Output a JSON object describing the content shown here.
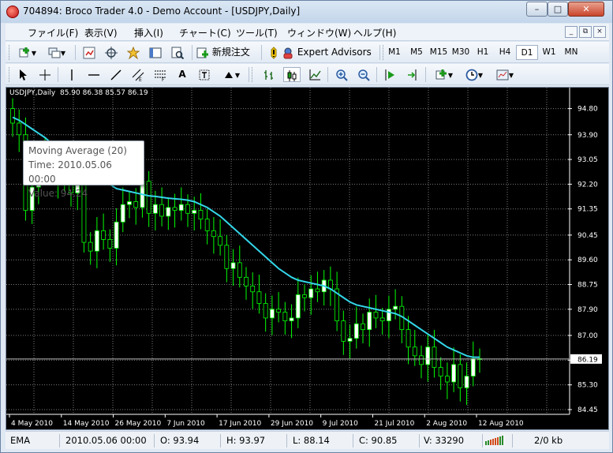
{
  "window": {
    "title": "704894: Broco Trader 4.0 - Demo Account - [USDJPY,Daily]",
    "minimize": "–",
    "maximize": "□",
    "close": "✕"
  },
  "menu": {
    "items": [
      "ファイル(F)",
      "表示(V)",
      "挿入(I)",
      "チャート(C)",
      "ツール(T)",
      "ウィンドウ(W)",
      "ヘルプ(H)"
    ],
    "mdi": [
      "_",
      "⧉",
      "×"
    ]
  },
  "toolbar1": {
    "new_order": "新規注文",
    "expert_advisors": "Expert Advisors",
    "timeframes": [
      "M1",
      "M5",
      "M15",
      "M30",
      "H1",
      "H4",
      "D1",
      "W1",
      "MN"
    ],
    "active_timeframe": "D1"
  },
  "toolbar2": {
    "text_tool": "A",
    "icons": [
      "cursor-icon",
      "crosshair-icon",
      "vertical-line-icon",
      "horizontal-line-icon",
      "trendline-icon",
      "equidistant-channel-icon",
      "fibonacci-icon",
      "text-icon",
      "text-label-icon",
      "arrows-icon",
      "bar-chart-icon",
      "candlestick-icon",
      "line-chart-icon",
      "zoom-in-icon",
      "zoom-out-icon",
      "chart-shift-icon",
      "autoscroll-icon",
      "indicators-icon",
      "periods-icon",
      "templates-icon"
    ]
  },
  "chart_header": {
    "symbol": "USDJPY,Daily",
    "ohlc": "85.90 86.38 85.57 86.19"
  },
  "tooltip": {
    "line1": "Moving Average (20)",
    "line2": "Time: 2010.05.06 00:00",
    "line3": "Value: 94.24"
  },
  "status": {
    "profile": "EMA",
    "datetime": "2010.05.06 00:00",
    "open": "O: 93.94",
    "high": "H: 93.97",
    "low": "L: 88.14",
    "close": "C: 90.85",
    "volume": "V: 33290",
    "traffic": "2/0 kb"
  },
  "colors": {
    "bull_candle": "#ffffff",
    "bear_candle": "#000000",
    "wick_and_outline": "#00ff00",
    "moving_average": "#33d6e8",
    "grid": "#7a7a7a",
    "price_label_bg": "#ffffff"
  },
  "chart_data": {
    "type": "candlestick",
    "symbol": "USDJPY",
    "timeframe": "Daily",
    "y_ticks": [
      "94.80",
      "93.90",
      "93.05",
      "92.20",
      "91.35",
      "90.45",
      "89.60",
      "88.75",
      "87.90",
      "87.00",
      "86.15",
      "85.30",
      "84.45"
    ],
    "ylim": [
      84.45,
      95.25
    ],
    "current_price": "86.19",
    "x_labels": [
      "4 May 2010",
      "14 May 2010",
      "26 May 2010",
      "7 Jun 2010",
      "17 Jun 2010",
      "29 Jun 2010",
      "9 Jul 2010",
      "21 Jul 2010",
      "2 Aug 2010",
      "12 Aug 2010"
    ],
    "x_label_index": [
      0,
      8,
      16,
      24,
      32,
      40,
      48,
      56,
      64,
      72
    ],
    "close": [
      94.3,
      93.9,
      91.3,
      92.1,
      92.8,
      93.2,
      92.7,
      92.3,
      92.6,
      91.9,
      92.2,
      90.2,
      89.9,
      90.6,
      90.3,
      90.0,
      90.9,
      91.5,
      91.6,
      91.4,
      92.3,
      91.2,
      91.5,
      91.1,
      91.4,
      91.3,
      91.5,
      91.2,
      91.3,
      91.0,
      90.6,
      90.4,
      90.1,
      89.3,
      89.5,
      89.0,
      88.7,
      88.5,
      88.1,
      87.6,
      87.9,
      87.8,
      87.5,
      87.6,
      88.4,
      88.3,
      88.6,
      88.5,
      88.9,
      88.6,
      87.5,
      86.8,
      86.9,
      87.4,
      87.2,
      87.8,
      87.6,
      87.5,
      87.9,
      88.0,
      87.2,
      86.6,
      86.3,
      86.0,
      86.6,
      85.9,
      85.6,
      85.4,
      86.0,
      85.2,
      85.6,
      86.2,
      86.19
    ],
    "ma20": [
      94.5,
      94.4,
      94.25,
      94.1,
      93.95,
      93.8,
      93.6,
      93.4,
      93.25,
      93.1,
      92.95,
      92.8,
      92.65,
      92.5,
      92.35,
      92.2,
      92.05,
      92.0,
      91.95,
      91.9,
      91.85,
      91.8,
      91.78,
      91.75,
      91.72,
      91.7,
      91.68,
      91.65,
      91.6,
      91.5,
      91.4,
      91.25,
      91.1,
      90.9,
      90.7,
      90.5,
      90.3,
      90.1,
      89.9,
      89.7,
      89.5,
      89.3,
      89.15,
      89.0,
      88.9,
      88.85,
      88.8,
      88.75,
      88.7,
      88.6,
      88.45,
      88.3,
      88.15,
      88.05,
      88.0,
      87.95,
      87.9,
      87.85,
      87.8,
      87.75,
      87.65,
      87.5,
      87.35,
      87.2,
      87.05,
      86.9,
      86.75,
      86.6,
      86.5,
      86.4,
      86.3,
      86.25,
      86.25
    ]
  }
}
